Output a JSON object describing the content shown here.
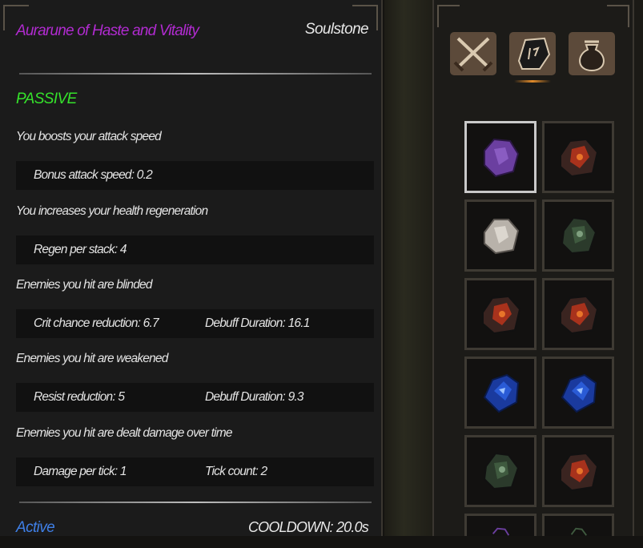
{
  "tooltip": {
    "title": "Aurarune of Haste and Vitality",
    "item_type": "Soulstone",
    "passive_label": "PASSIVE",
    "effects": [
      {
        "description": "You boosts your attack speed",
        "stats": [
          "Bonus attack speed: 0.2"
        ]
      },
      {
        "description": "You increases your health regeneration",
        "stats": [
          "Regen per stack: 4"
        ]
      },
      {
        "description": "Enemies you hit are blinded",
        "stats": [
          "Crit chance reduction: 6.7",
          "Debuff Duration: 16.1"
        ]
      },
      {
        "description": "Enemies you hit are weakened",
        "stats": [
          "Resist reduction: 5",
          "Debuff Duration: 9.3"
        ]
      },
      {
        "description": "Enemies you hit are dealt damage over time",
        "stats": [
          "Damage per tick: 1",
          "Tick count: 2"
        ]
      }
    ],
    "active_label": "Active",
    "cooldown": "COOLDOWN: 20.0s"
  },
  "inventory": {
    "tabs": [
      {
        "icon": "crossed-swords-icon"
      },
      {
        "icon": "rune-stone-icon",
        "selected": true
      },
      {
        "icon": "loot-bag-icon"
      }
    ],
    "slots": [
      {
        "item": "purple-soulstone-icon",
        "selected": true,
        "color": "#6b3fa0"
      },
      {
        "item": "red-soulstone-icon",
        "color": "#a8321c"
      },
      {
        "item": "white-soulstone-icon",
        "color": "#b8b2aa"
      },
      {
        "item": "green-soulstone-icon",
        "color": "#3f5a3f"
      },
      {
        "item": "red-soulstone-icon",
        "color": "#a8321c"
      },
      {
        "item": "red-soulstone-icon",
        "color": "#a8321c"
      },
      {
        "item": "blue-soulstone-icon",
        "color": "#2a5bd6"
      },
      {
        "item": "blue-soulstone-icon",
        "color": "#2a5bd6"
      },
      {
        "item": "green-soulstone-icon",
        "color": "#3f5a3f"
      },
      {
        "item": "red-soulstone-icon",
        "color": "#a8321c"
      },
      {
        "item": "purple-soulstone-icon",
        "color": "#6b3fa0"
      },
      {
        "item": "green-soulstone-icon",
        "color": "#3f5a3f"
      }
    ]
  }
}
